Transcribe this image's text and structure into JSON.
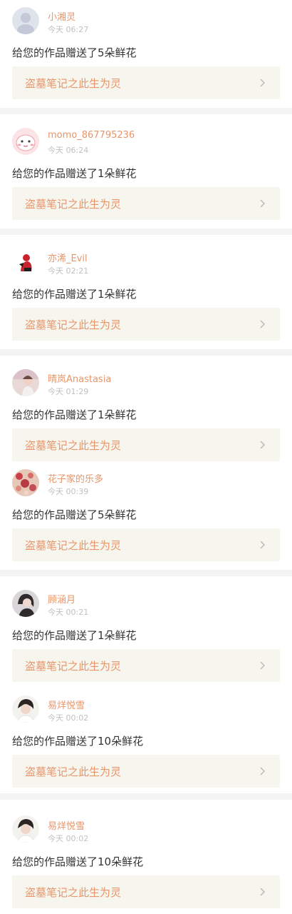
{
  "feed": {
    "items": [
      {
        "username": "小湘灵",
        "time": "今天 06:27",
        "message": "给您的作品赠送了5朵鲜花",
        "work_title": "盗墓笔记之此生为灵",
        "avatar_icon": "default-avatar-icon"
      },
      {
        "username": "momo_867795236",
        "time": "今天 06:24",
        "message": "给您的作品赠送了1朵鲜花",
        "work_title": "盗墓笔记之此生为灵",
        "avatar_icon": "pink-cartoon-avatar-icon"
      },
      {
        "username": "亦浠_Evil",
        "time": "今天 02:21",
        "message": "给您的作品赠送了1朵鲜花",
        "work_title": "盗墓笔记之此生为灵",
        "avatar_icon": "red-figure-avatar-icon"
      },
      {
        "username": "晴岚Anastasia",
        "time": "今天 01:29",
        "message": "给您的作品赠送了1朵鲜花",
        "work_title": "盗墓笔记之此生为灵",
        "avatar_icon": "photo-avatar-icon"
      },
      {
        "username": "花子家的乐多",
        "time": "今天 00:39",
        "message": "给您的作品赠送了5朵鲜花",
        "work_title": "盗墓笔记之此生为灵",
        "avatar_icon": "floral-avatar-icon"
      },
      {
        "username": "顾涵月",
        "time": "今天 00:21",
        "message": "给您的作品赠送了1朵鲜花",
        "work_title": "盗墓笔记之此生为灵",
        "avatar_icon": "portrait-avatar-icon"
      },
      {
        "username": "易烊悦雪",
        "time": "今天 00:02",
        "message": "给您的作品赠送了10朵鲜花",
        "work_title": "盗墓笔记之此生为灵",
        "avatar_icon": "portrait-avatar-icon"
      },
      {
        "username": "易烊悦雪",
        "time": "今天 00:02",
        "message": "给您的作品赠送了10朵鲜花",
        "work_title": "盗墓笔记之此生为灵",
        "avatar_icon": "portrait-avatar-icon"
      }
    ]
  },
  "colors": {
    "accent": "#e8956a",
    "link_background": "#f6f6ef",
    "separator": "#f4f4f4",
    "time_text": "#c0c0c0",
    "message_text": "#333333"
  }
}
